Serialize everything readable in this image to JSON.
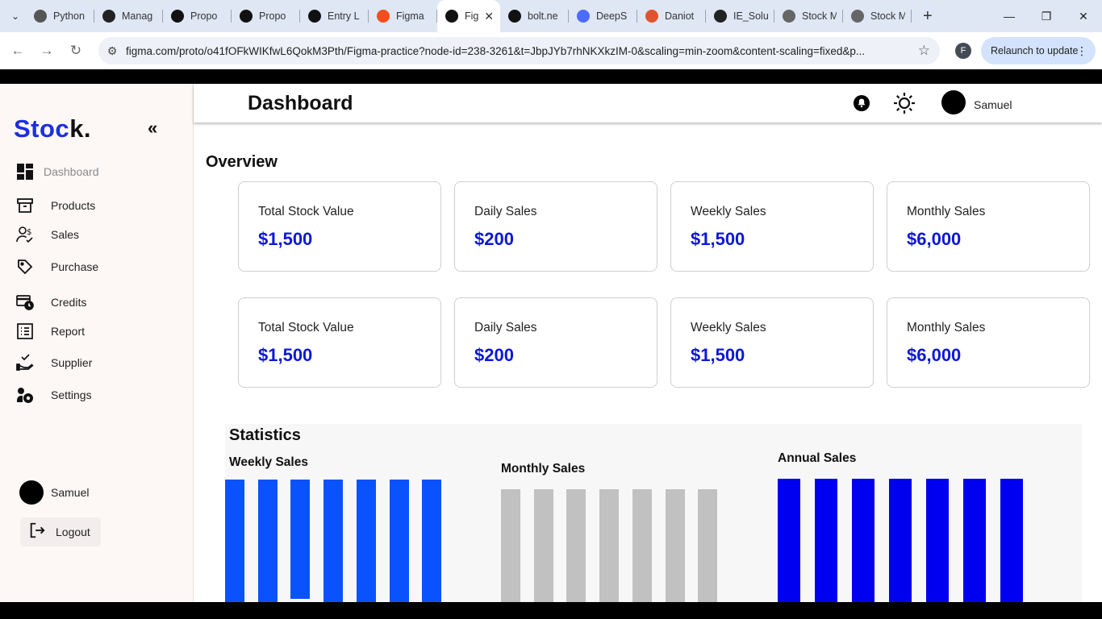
{
  "browser": {
    "tabs": [
      {
        "title": "Python",
        "color": "#555"
      },
      {
        "title": "Manag",
        "color": "#222"
      },
      {
        "title": "Propo",
        "color": "#111"
      },
      {
        "title": "Propo",
        "color": "#111"
      },
      {
        "title": "Entry L",
        "color": "#111"
      },
      {
        "title": "Figma",
        "color": "#f24e1e"
      },
      {
        "title": "Fig",
        "color": "#111",
        "active": true
      },
      {
        "title": "bolt.ne",
        "color": "#111"
      },
      {
        "title": "DeepS",
        "color": "#4d6bfe"
      },
      {
        "title": "Daniot",
        "color": "#e0532d"
      },
      {
        "title": "IE_Solu",
        "color": "#222"
      },
      {
        "title": "Stock M",
        "color": "#666"
      },
      {
        "title": "Stock M",
        "color": "#666"
      }
    ],
    "url": "figma.com/proto/o41fOFkWIKfwL6QokM3Pth/Figma-practice?node-id=238-3261&t=JbpJYb7rhNKXkzIM-0&scaling=min-zoom&content-scaling=fixed&p...",
    "profile_initial": "F",
    "relaunch_label": "Relaunch to update"
  },
  "sidebar": {
    "logo_part1": "Stoc",
    "logo_part2": "k.",
    "items": [
      {
        "label": "Dashboard",
        "icon": "dashboard-icon",
        "active": true
      },
      {
        "label": "Products",
        "icon": "archive-icon"
      },
      {
        "label": "Sales",
        "icon": "sales-person-icon"
      },
      {
        "label": "Purchase",
        "icon": "tag-icon"
      },
      {
        "label": "Credits",
        "icon": "credit-card-clock-icon"
      },
      {
        "label": "Report",
        "icon": "list-icon"
      },
      {
        "label": "Supplier",
        "icon": "supplier-hand-icon"
      },
      {
        "label": "Settings",
        "icon": "settings-icon"
      }
    ],
    "user_name": "Samuel",
    "logout_label": "Logout"
  },
  "header": {
    "title": "Dashboard",
    "user_name": "Samuel"
  },
  "overview": {
    "title": "Overview",
    "cards_row1": [
      {
        "label": "Total Stock Value",
        "value": "$1,500"
      },
      {
        "label": "Daily Sales",
        "value": "$200"
      },
      {
        "label": "Weekly Sales",
        "value": "$1,500"
      },
      {
        "label": "Monthly Sales",
        "value": "$6,000"
      }
    ],
    "cards_row2": [
      {
        "label": "Total Stock Value",
        "value": "$1,500"
      },
      {
        "label": "Daily Sales",
        "value": "$200"
      },
      {
        "label": "Weekly Sales",
        "value": "$1,500"
      },
      {
        "label": "Monthly Sales",
        "value": "$6,000"
      }
    ]
  },
  "statistics": {
    "title": "Statistics",
    "charts": [
      {
        "title": "Weekly Sales",
        "color": "#0b52ff",
        "bars": 7
      },
      {
        "title": "Monthly Sales",
        "color": "#c1c1c1",
        "bars": 7
      },
      {
        "title": "Annual Sales",
        "color": "#0000f0",
        "bars": 7
      }
    ]
  }
}
